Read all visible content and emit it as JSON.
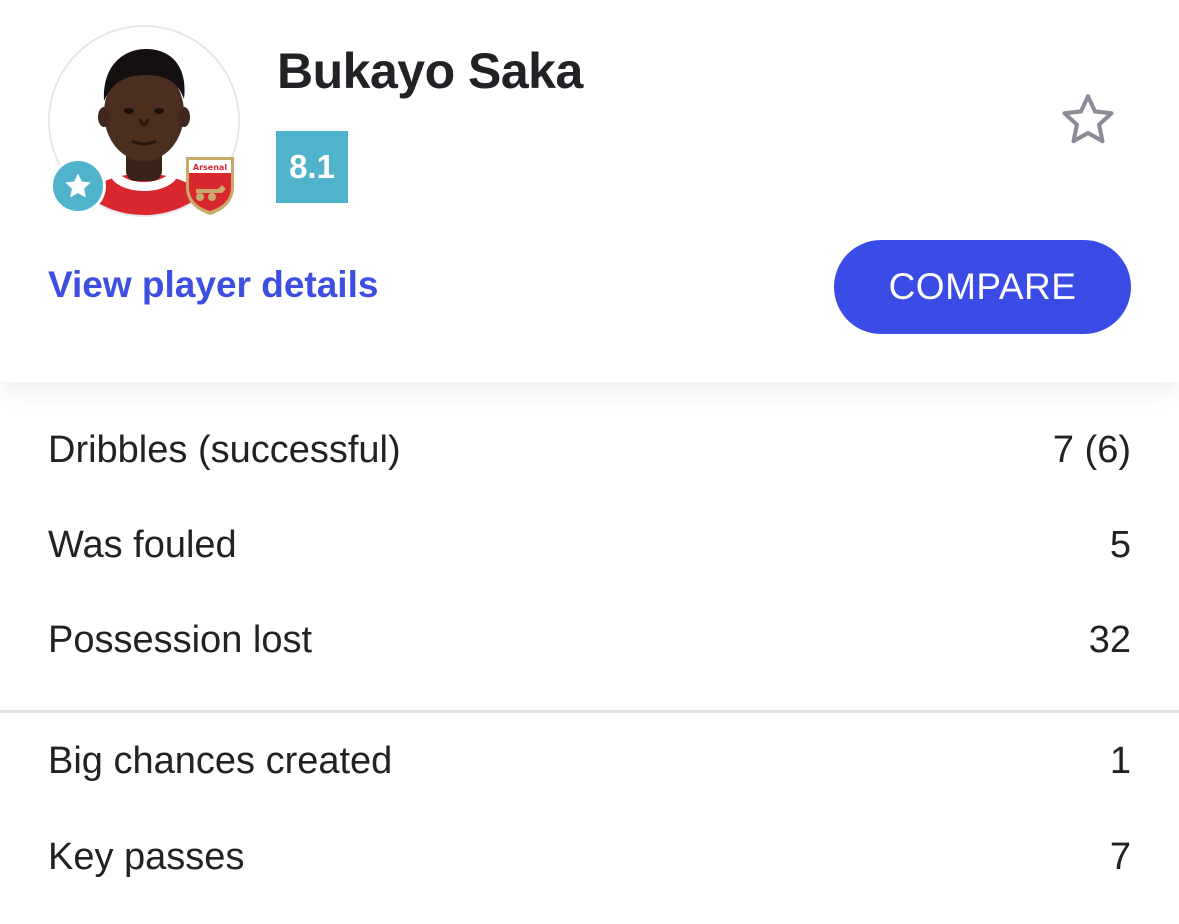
{
  "player": {
    "name": "Bukayo Saka",
    "rating": "8.1",
    "club_crest_text": "Arsenal"
  },
  "actions": {
    "details_link": "View player details",
    "compare_label": "COMPARE"
  },
  "colors": {
    "accent_blue": "#3a4be6",
    "rating_teal": "#4fb3cc",
    "text": "#222226"
  },
  "icons": {
    "favorite": "star-outline-icon",
    "top_player_badge": "star-badge-icon"
  },
  "stats_group_1": [
    {
      "label": "Dribbles (successful)",
      "value": "7 (6)"
    },
    {
      "label": "Was fouled",
      "value": "5"
    },
    {
      "label": "Possession lost",
      "value": "32"
    }
  ],
  "stats_group_2": [
    {
      "label": "Big chances created",
      "value": "1"
    },
    {
      "label": "Key passes",
      "value": "7"
    }
  ]
}
